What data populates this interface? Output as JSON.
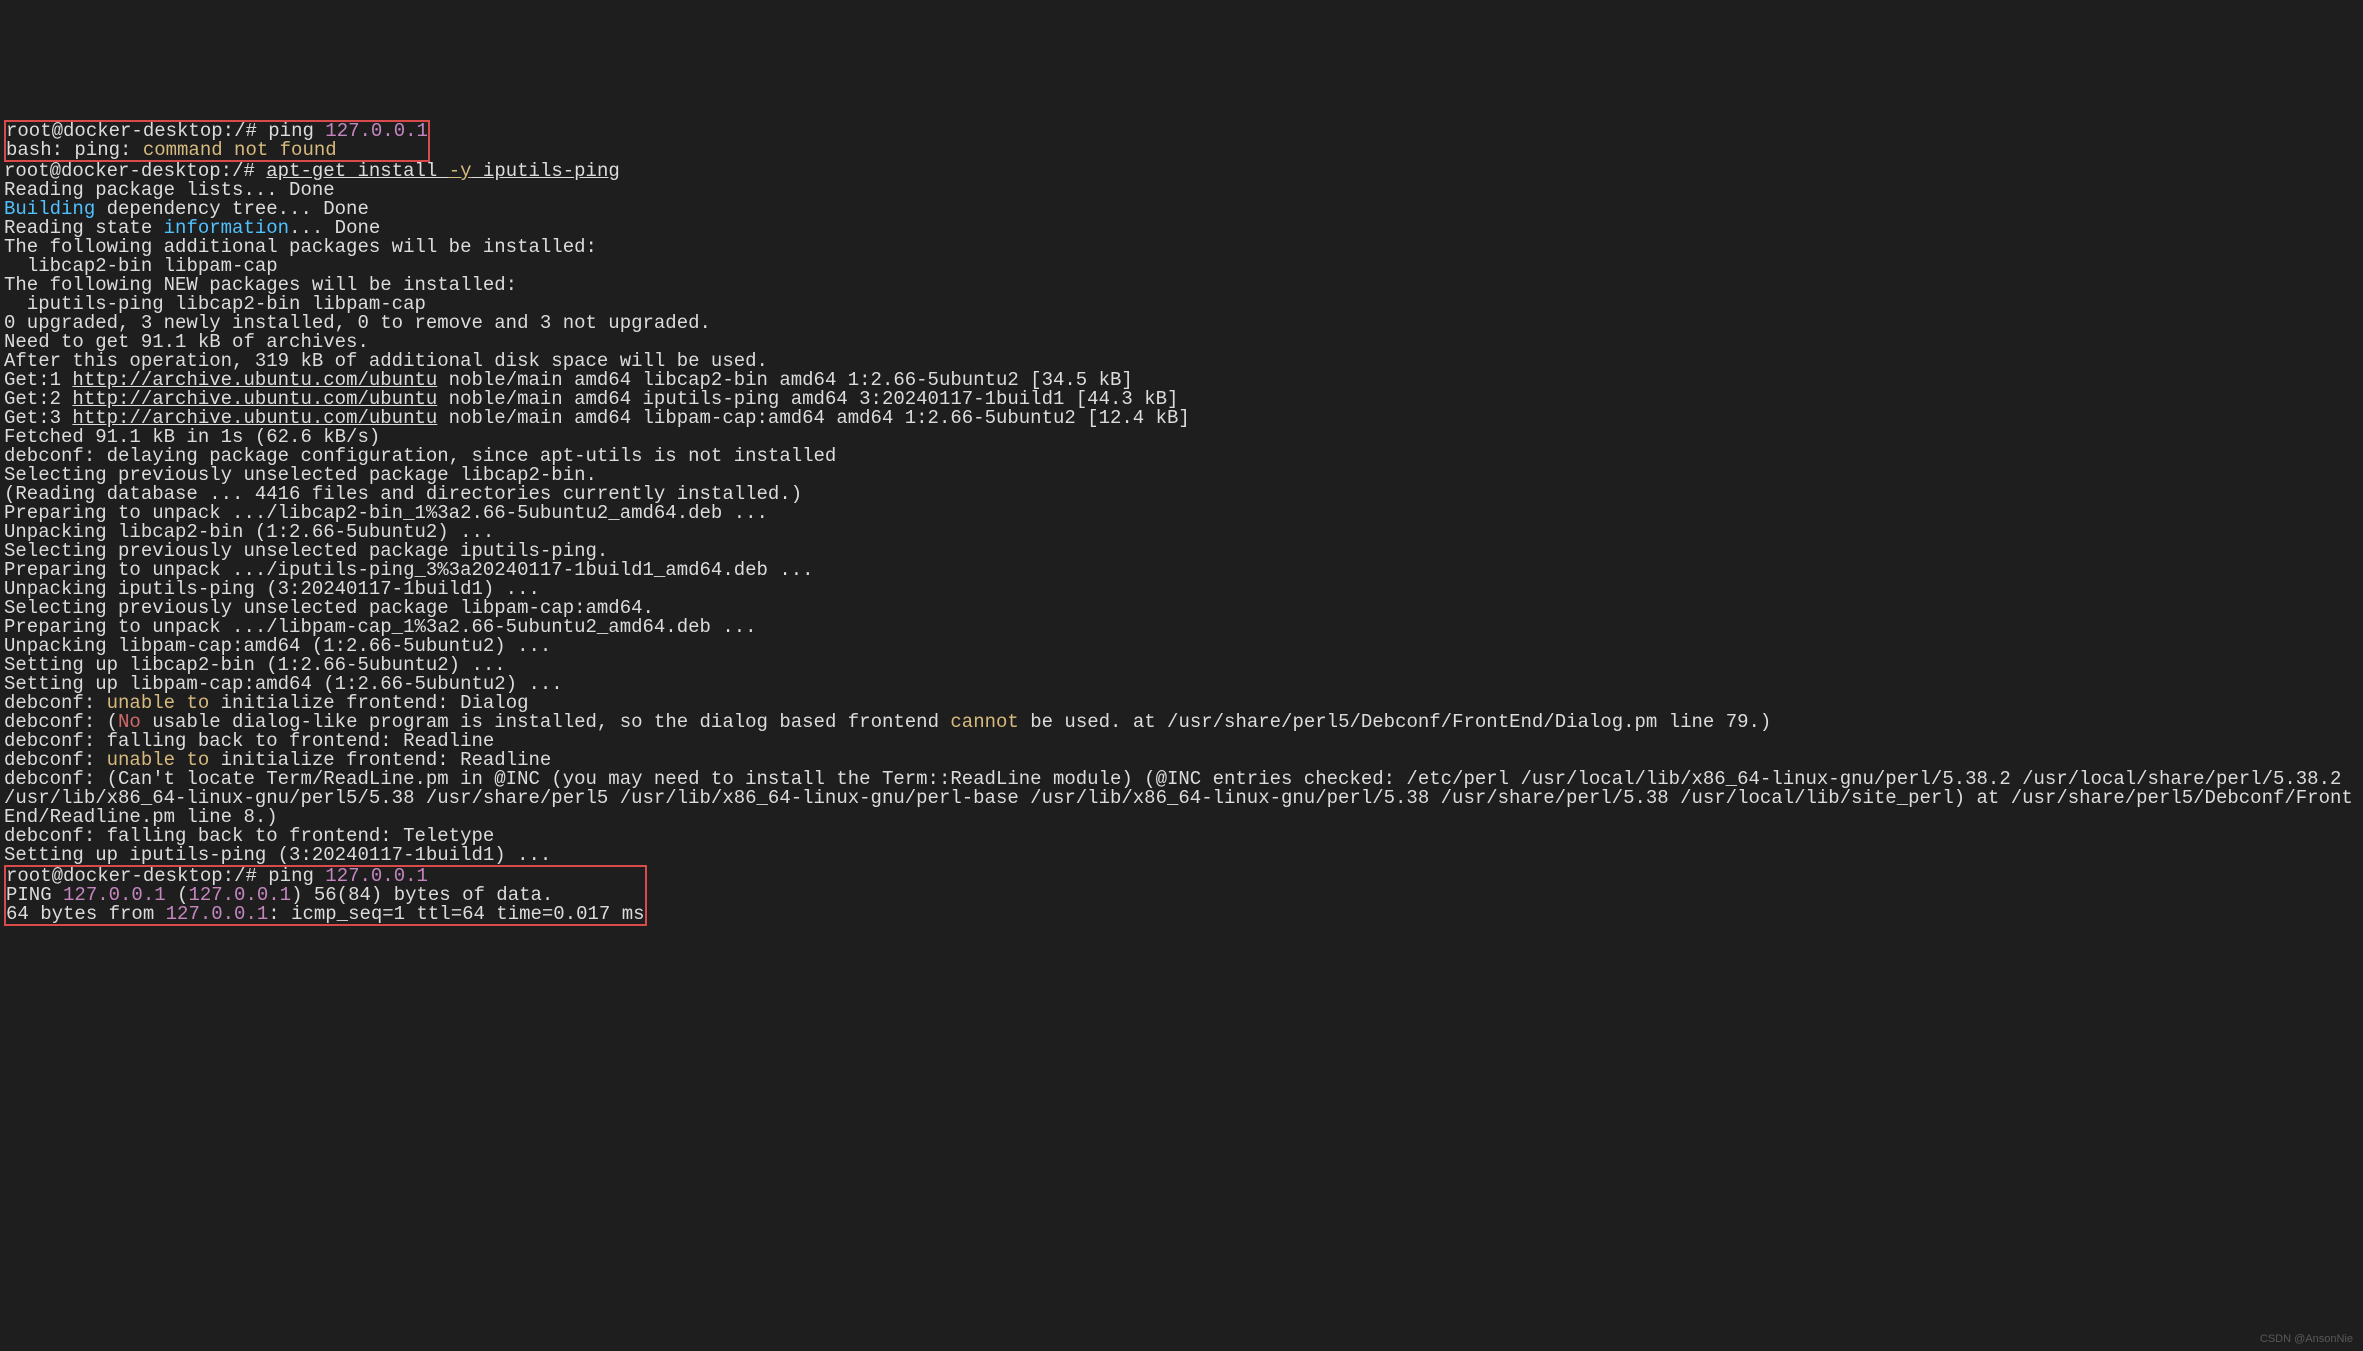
{
  "prompt": {
    "user": "root",
    "host": "docker-desktop",
    "path": "/",
    "sep": "@",
    "suffix": ":",
    "hash": "# "
  },
  "cmd1": {
    "cmd": "ping ",
    "arg": "127.0.0.1"
  },
  "err1": {
    "prefix": "bash: ping: ",
    "msg": "command not found"
  },
  "cmd2": {
    "cmd": "apt-get install ",
    "flag": "-y",
    "pkg": " iputils-ping"
  },
  "apt": {
    "l01": "Reading package lists... Done",
    "l02a": "Building",
    "l02b": " dependency tree... Done",
    "l03a": "Reading state ",
    "l03b": "information",
    "l03c": "... Done",
    "l04": "The following additional packages will be installed:",
    "l05": "  libcap2-bin libpam-cap",
    "l06": "The following NEW packages will be installed:",
    "l07": "  iputils-ping libcap2-bin libpam-cap",
    "l08": "0 upgraded, 3 newly installed, 0 to remove and 3 not upgraded.",
    "l09": "Need to get 91.1 kB of archives.",
    "l10": "After this operation, 319 kB of additional disk space will be used.",
    "g1a": "Get:1 ",
    "g1u": "http://archive.ubuntu.com/ubuntu",
    "g1b": " noble/main amd64 libcap2-bin amd64 1:2.66-5ubuntu2 [34.5 kB]",
    "g2a": "Get:2 ",
    "g2u": "http://archive.ubuntu.com/ubuntu",
    "g2b": " noble/main amd64 iputils-ping amd64 3:20240117-1build1 [44.3 kB]",
    "g3a": "Get:3 ",
    "g3u": "http://archive.ubuntu.com/ubuntu",
    "g3b": " noble/main amd64 libpam-cap:amd64 amd64 1:2.66-5ubuntu2 [12.4 kB]",
    "l14": "Fetched 91.1 kB in 1s (62.6 kB/s)",
    "l15": "debconf: delaying package configuration, since apt-utils is not installed",
    "l16": "Selecting previously unselected package libcap2-bin.",
    "l17": "(Reading database ... 4416 files and directories currently installed.)",
    "l18": "Preparing to unpack .../libcap2-bin_1%3a2.66-5ubuntu2_amd64.deb ...",
    "l19": "Unpacking libcap2-bin (1:2.66-5ubuntu2) ...",
    "l20": "Selecting previously unselected package iputils-ping.",
    "l21": "Preparing to unpack .../iputils-ping_3%3a20240117-1build1_amd64.deb ...",
    "l22": "Unpacking iputils-ping (3:20240117-1build1) ...",
    "l23": "Selecting previously unselected package libpam-cap:amd64.",
    "l24": "Preparing to unpack .../libpam-cap_1%3a2.66-5ubuntu2_amd64.deb ...",
    "l25": "Unpacking libpam-cap:amd64 (1:2.66-5ubuntu2) ...",
    "l26": "Setting up libcap2-bin (1:2.66-5ubuntu2) ...",
    "l27": "Setting up libpam-cap:amd64 (1:2.66-5ubuntu2) ...",
    "d1a": "debconf: ",
    "d1b": "unable to",
    "d1c": " initialize frontend: Dialog",
    "d2a": "debconf: (",
    "d2b": "No",
    "d2c": " usable dialog-like program is installed, so the dialog based frontend ",
    "d2d": "cannot",
    "d2e": " be used. at /usr/share/perl5/Debconf/FrontEnd/Dialog.pm line 79.)",
    "d3": "debconf: falling back to frontend: Readline",
    "d4a": "debconf: ",
    "d4b": "unable to",
    "d4c": " initialize frontend: Readline",
    "d5": "debconf: (Can't locate Term/ReadLine.pm in @INC (you may need to install the Term::ReadLine module) (@INC entries checked: /etc/perl /usr/local/lib/x86_64-linux-gnu/perl/5.38.2 /usr/local/share/perl/5.38.2 /usr/lib/x86_64-linux-gnu/perl5/5.38 /usr/share/perl5 /usr/lib/x86_64-linux-gnu/perl-base /usr/lib/x86_64-linux-gnu/perl/5.38 /usr/share/perl/5.38 /usr/local/lib/site_perl) at /usr/share/perl5/Debconf/FrontEnd/Readline.pm line 8.)",
    "d6": "debconf: falling back to frontend: Teletype",
    "l34": "Setting up iputils-ping (3:20240117-1build1) ..."
  },
  "cmd3": {
    "cmd": "ping ",
    "arg": "127.0.0.1"
  },
  "ping": {
    "l1a": "PING ",
    "ip1": "127.0.0.1",
    "l1b": " (",
    "ip2": "127.0.0.1",
    "l1c": ") 56(84) bytes of data.",
    "l2a": "64 bytes from ",
    "ip3": "127.0.0.1",
    "l2b": ": icmp_seq=1 ttl=64 time=0.017 ms"
  },
  "watermark": "CSDN @AnsonNie"
}
